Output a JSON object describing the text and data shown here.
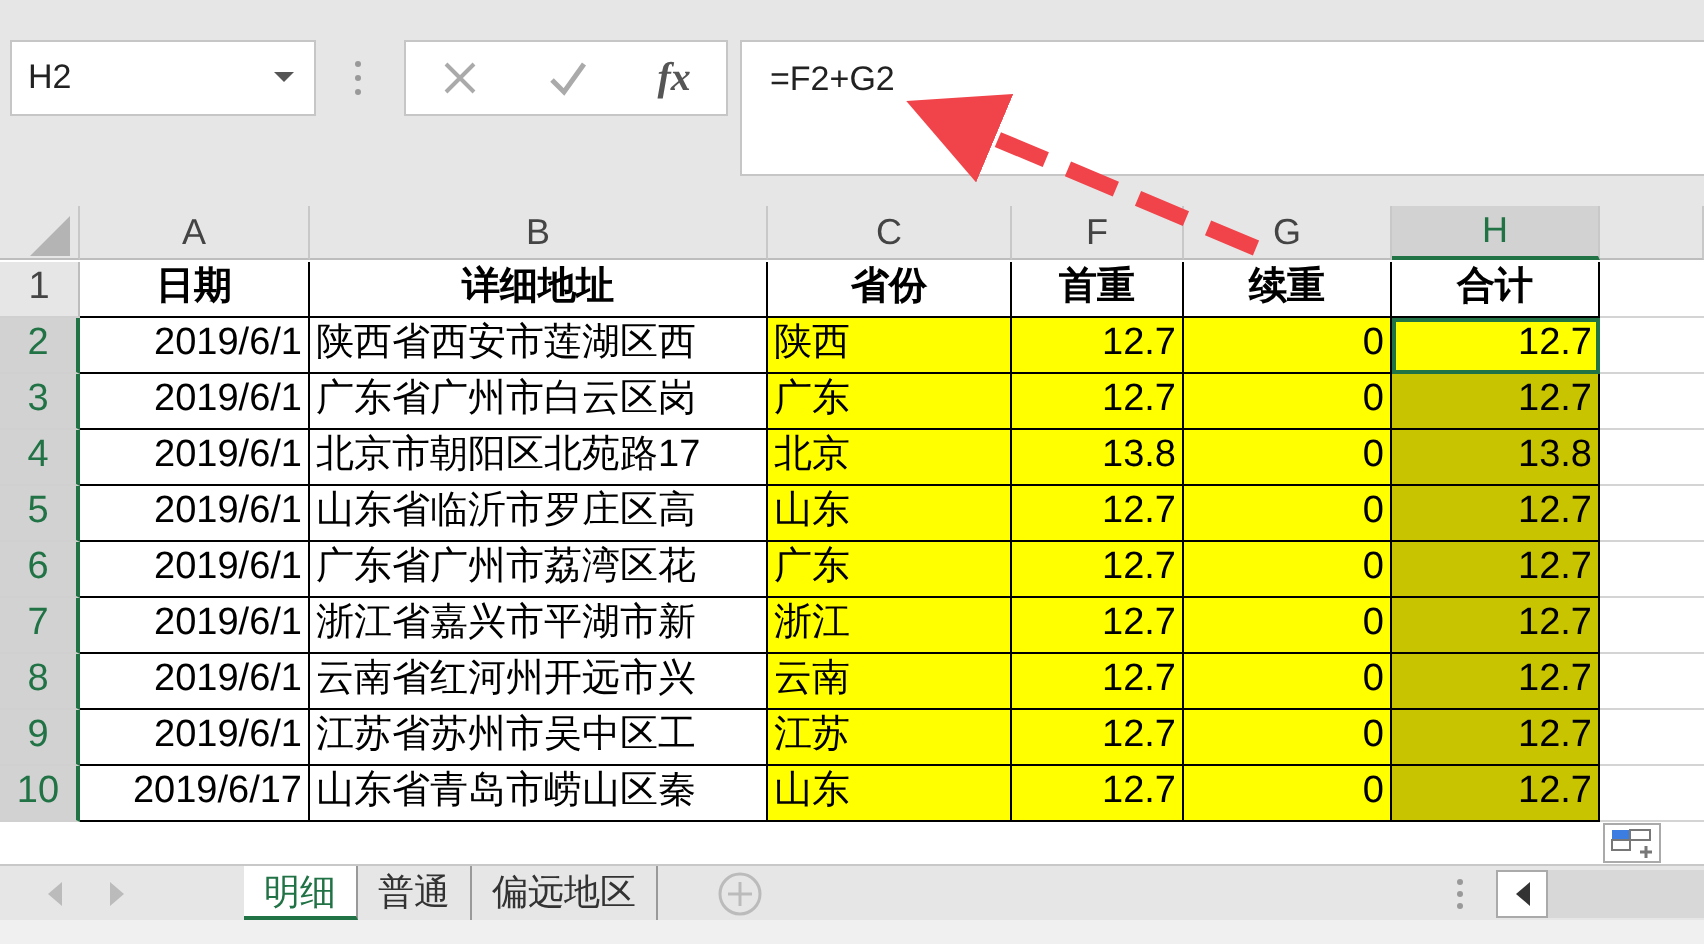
{
  "name_box": {
    "value": "H2"
  },
  "formula_bar": {
    "fx": "fx",
    "value": "=F2+G2"
  },
  "columns": [
    {
      "label": "A",
      "kind": "date",
      "highlighted": false,
      "selected": false
    },
    {
      "label": "B",
      "kind": "text",
      "highlighted": false,
      "selected": false
    },
    {
      "label": "C",
      "kind": "text",
      "highlighted": true,
      "selected": false
    },
    {
      "label": "F",
      "kind": "number",
      "highlighted": true,
      "selected": false
    },
    {
      "label": "G",
      "kind": "number",
      "highlighted": true,
      "selected": false
    },
    {
      "label": "H",
      "kind": "number",
      "highlighted": true,
      "selected": true
    }
  ],
  "rows": [
    {
      "number": "1",
      "kind": "header",
      "selected": false,
      "active": false,
      "cells": [
        "日期",
        "详细地址",
        "省份",
        "首重",
        "续重",
        "合计"
      ]
    },
    {
      "number": "2",
      "kind": "data",
      "selected": true,
      "active": true,
      "cells": [
        "2019/6/1",
        "陕西省西安市莲湖区西",
        "陕西",
        "12.7",
        "0",
        "12.7"
      ]
    },
    {
      "number": "3",
      "kind": "data",
      "selected": true,
      "active": false,
      "cells": [
        "2019/6/1",
        "广东省广州市白云区岗",
        "广东",
        "12.7",
        "0",
        "12.7"
      ]
    },
    {
      "number": "4",
      "kind": "data",
      "selected": true,
      "active": false,
      "cells": [
        "2019/6/1",
        "北京市朝阳区北苑路17",
        "北京",
        "13.8",
        "0",
        "13.8"
      ]
    },
    {
      "number": "5",
      "kind": "data",
      "selected": true,
      "active": false,
      "cells": [
        "2019/6/1",
        "山东省临沂市罗庄区高",
        "山东",
        "12.7",
        "0",
        "12.7"
      ]
    },
    {
      "number": "6",
      "kind": "data",
      "selected": true,
      "active": false,
      "cells": [
        "2019/6/1",
        "广东省广州市荔湾区花",
        "广东",
        "12.7",
        "0",
        "12.7"
      ]
    },
    {
      "number": "7",
      "kind": "data",
      "selected": true,
      "active": false,
      "cells": [
        "2019/6/1",
        "浙江省嘉兴市平湖市新",
        "浙江",
        "12.7",
        "0",
        "12.7"
      ]
    },
    {
      "number": "8",
      "kind": "data",
      "selected": true,
      "active": false,
      "cells": [
        "2019/6/1",
        "云南省红河州开远市兴",
        "云南",
        "12.7",
        "0",
        "12.7"
      ]
    },
    {
      "number": "9",
      "kind": "data",
      "selected": true,
      "active": false,
      "cells": [
        "2019/6/1",
        "江苏省苏州市吴中区工",
        "江苏",
        "12.7",
        "0",
        "12.7"
      ]
    },
    {
      "number": "10",
      "kind": "data",
      "selected": true,
      "active": false,
      "cells": [
        "2019/6/17",
        "山东省青岛市崂山区秦",
        "山东",
        "12.7",
        "0",
        "12.7"
      ]
    }
  ],
  "sheet_tabs": [
    {
      "label": "明细",
      "selected": true
    },
    {
      "label": "普通",
      "selected": false
    },
    {
      "label": "偏远地区",
      "selected": false
    }
  ]
}
